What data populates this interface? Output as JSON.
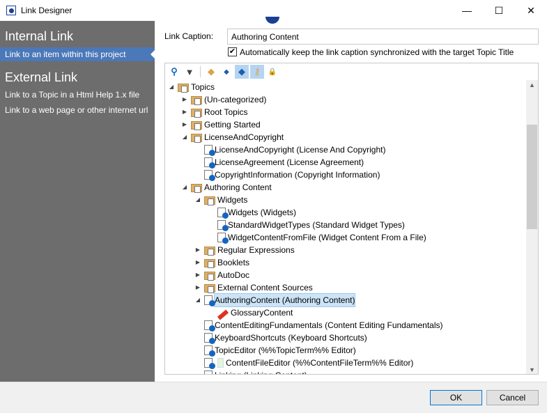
{
  "window": {
    "title": "Link Designer",
    "minimize": "—",
    "maximize": "☐",
    "close": "✕"
  },
  "sidebar": {
    "internal_heading": "Internal Link",
    "internal_items": [
      {
        "label": "Link to an item within this project",
        "selected": true
      }
    ],
    "external_heading": "External Link",
    "external_items": [
      {
        "label": "Link to a Topic in a Html Help 1.x file"
      },
      {
        "label": "Link to a web page or other internet url"
      }
    ]
  },
  "caption": {
    "label": "Link Caption:",
    "value": "Authoring Content",
    "sync_checked": true,
    "sync_label": "Automatically keep the link caption synchronized with the target Topic Title"
  },
  "toolbar": {
    "icons": [
      "search-icon",
      "filter-icon",
      "topic-types-icon",
      "diamond-icon",
      "keywords-icon",
      "key-icon",
      "lock-icon"
    ]
  },
  "tree": [
    {
      "label": "Topics",
      "level": 0,
      "type": "folder",
      "exp": "open"
    },
    {
      "label": "(Un-categorized)",
      "level": 1,
      "type": "folder",
      "exp": "closed"
    },
    {
      "label": "Root Topics",
      "level": 1,
      "type": "folder",
      "exp": "closed"
    },
    {
      "label": "Getting Started",
      "level": 1,
      "type": "folder",
      "exp": "closed"
    },
    {
      "label": "LicenseAndCopyright",
      "level": 1,
      "type": "folder",
      "exp": "open"
    },
    {
      "label": "LicenseAndCopyright (License And Copyright)",
      "level": 2,
      "type": "topic",
      "exp": ""
    },
    {
      "label": "LicenseAgreement (License Agreement)",
      "level": 2,
      "type": "topic",
      "exp": ""
    },
    {
      "label": "CopyrightInformation (Copyright Information)",
      "level": 2,
      "type": "topic",
      "exp": ""
    },
    {
      "label": "Authoring Content",
      "level": 1,
      "type": "folder",
      "exp": "open"
    },
    {
      "label": "Widgets",
      "level": 2,
      "type": "folder",
      "exp": "open"
    },
    {
      "label": "Widgets (Widgets)",
      "level": 3,
      "type": "topic",
      "exp": ""
    },
    {
      "label": "StandardWidgetTypes (Standard Widget Types)",
      "level": 3,
      "type": "topic",
      "exp": ""
    },
    {
      "label": "WidgetContentFromFile (Widget Content From a File)",
      "level": 3,
      "type": "topic",
      "exp": ""
    },
    {
      "label": "Regular Expressions",
      "level": 2,
      "type": "folder",
      "exp": "closed"
    },
    {
      "label": "Booklets",
      "level": 2,
      "type": "folder",
      "exp": "closed"
    },
    {
      "label": "AutoDoc",
      "level": 2,
      "type": "folder",
      "exp": "closed"
    },
    {
      "label": "External Content Sources",
      "level": 2,
      "type": "folder",
      "exp": "closed"
    },
    {
      "label": "AuthoringContent (Authoring Content)",
      "level": 2,
      "type": "topic",
      "exp": "open",
      "selected": true
    },
    {
      "label": "GlossaryContent",
      "level": 3,
      "type": "glossary",
      "exp": ""
    },
    {
      "label": "ContentEditingFundamentals (Content Editing Fundamentals)",
      "level": 2,
      "type": "topic",
      "exp": ""
    },
    {
      "label": "KeyboardShortcuts (Keyboard Shortcuts)",
      "level": 2,
      "type": "topic",
      "exp": ""
    },
    {
      "label": "TopicEditor (%%TopicTerm%% Editor)",
      "level": 2,
      "type": "topic",
      "exp": ""
    },
    {
      "label": "ContentFileEditor (%%ContentFileTerm%% Editor)",
      "level": 2,
      "type": "topic-file",
      "exp": ""
    },
    {
      "label": "Linking (Linking Content)",
      "level": 2,
      "type": "topic",
      "exp": ""
    }
  ],
  "buttons": {
    "ok": "OK",
    "cancel": "Cancel"
  }
}
